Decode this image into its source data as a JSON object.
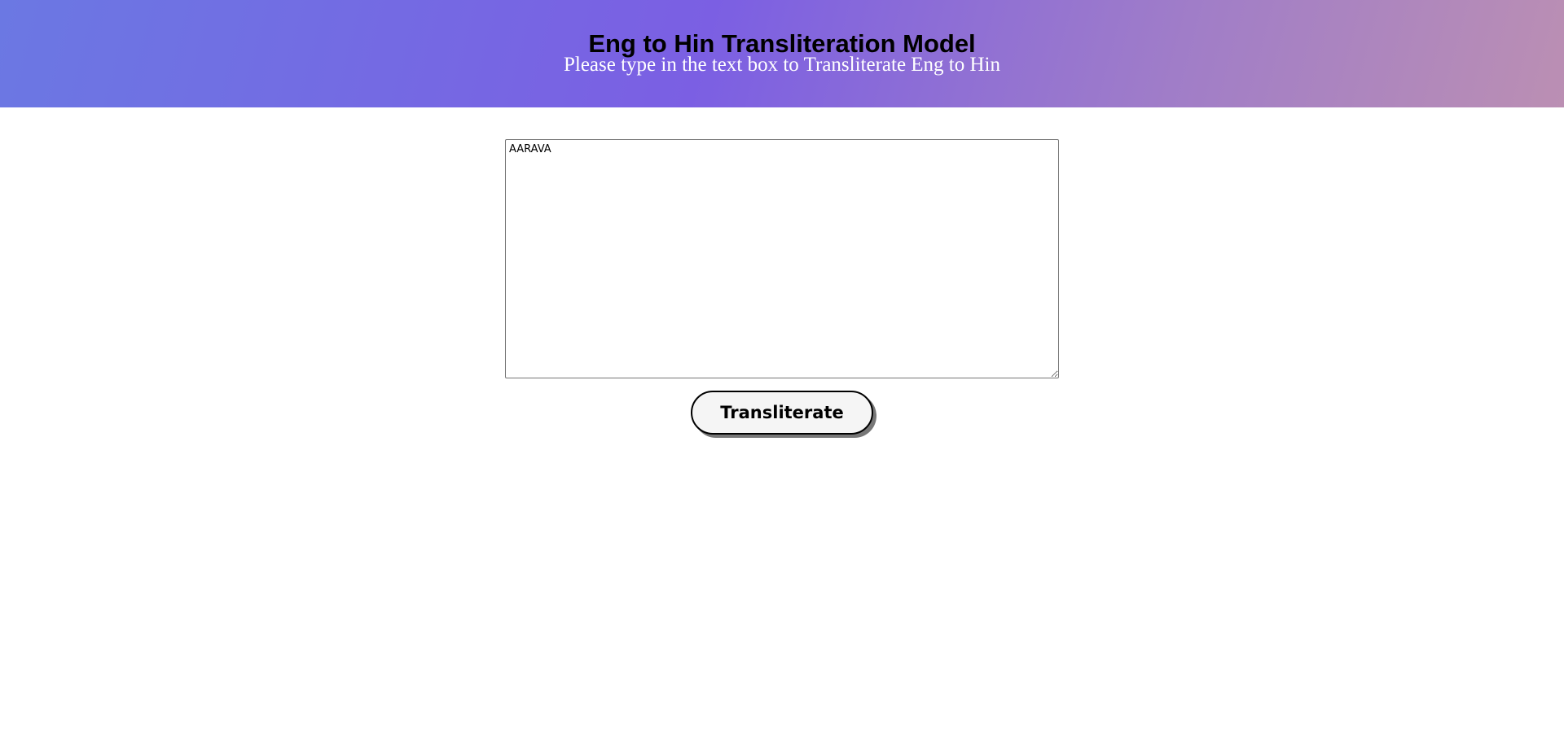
{
  "header": {
    "title": "Eng to Hin Transliteration Model",
    "subtitle": "Please type in the text box to Transliterate Eng to Hin"
  },
  "form": {
    "input_value": "AARAVA",
    "submit_label": "Transliterate"
  },
  "colors": {
    "header_gradient_start": "#667eea",
    "header_gradient_mid": "#7b5fe3",
    "header_gradient_end": "#bb8fb3"
  }
}
